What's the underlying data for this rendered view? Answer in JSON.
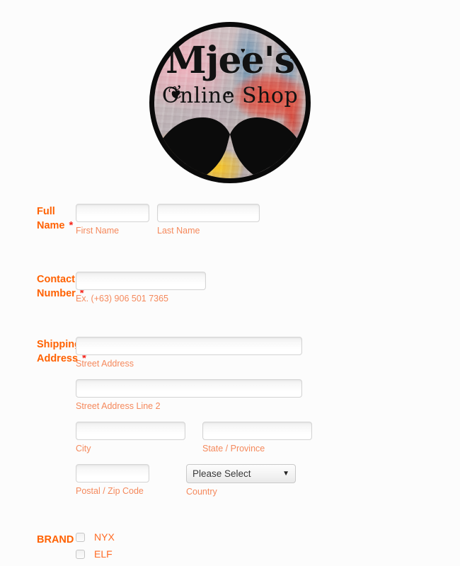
{
  "logo": {
    "line1": "Mjee's",
    "line2": "Online Shop",
    "heart": "♥",
    "bird": "❦"
  },
  "form": {
    "required_star": "*",
    "fields": [
      {
        "label": "Full Name",
        "required": true,
        "inputs": [
          {
            "value": "",
            "placeholder": "",
            "sub": "First Name"
          },
          {
            "value": "",
            "placeholder": "",
            "sub": "Last Name"
          }
        ]
      },
      {
        "label": "Contact Number",
        "required": true,
        "inputs": [
          {
            "value": "",
            "placeholder": "",
            "sub": "Ex. (+63) 906 501 7365"
          }
        ]
      },
      {
        "label": "Shipping Address",
        "required": true,
        "inputs": [
          {
            "value": "",
            "placeholder": "",
            "sub": "Street Address"
          },
          {
            "value": "",
            "placeholder": "",
            "sub": "Street Address Line 2"
          },
          {
            "value": "",
            "placeholder": "",
            "sub": "City"
          },
          {
            "value": "",
            "placeholder": "",
            "sub": "State / Province"
          },
          {
            "value": "",
            "placeholder": "",
            "sub": "Postal / Zip Code"
          },
          {
            "value": "Please Select",
            "sub": "Country"
          }
        ]
      },
      {
        "label": "BRAND",
        "required": true,
        "checkboxes": [
          {
            "label": "NYX",
            "checked": false
          },
          {
            "label": "ELF",
            "checked": false
          }
        ]
      }
    ]
  },
  "colors": {
    "label": "#ff6100",
    "asterisk": "#f5241b",
    "sublabel": "#f5895c",
    "checkbox_label": "#ff6a23",
    "background": "#fcfcfc"
  }
}
